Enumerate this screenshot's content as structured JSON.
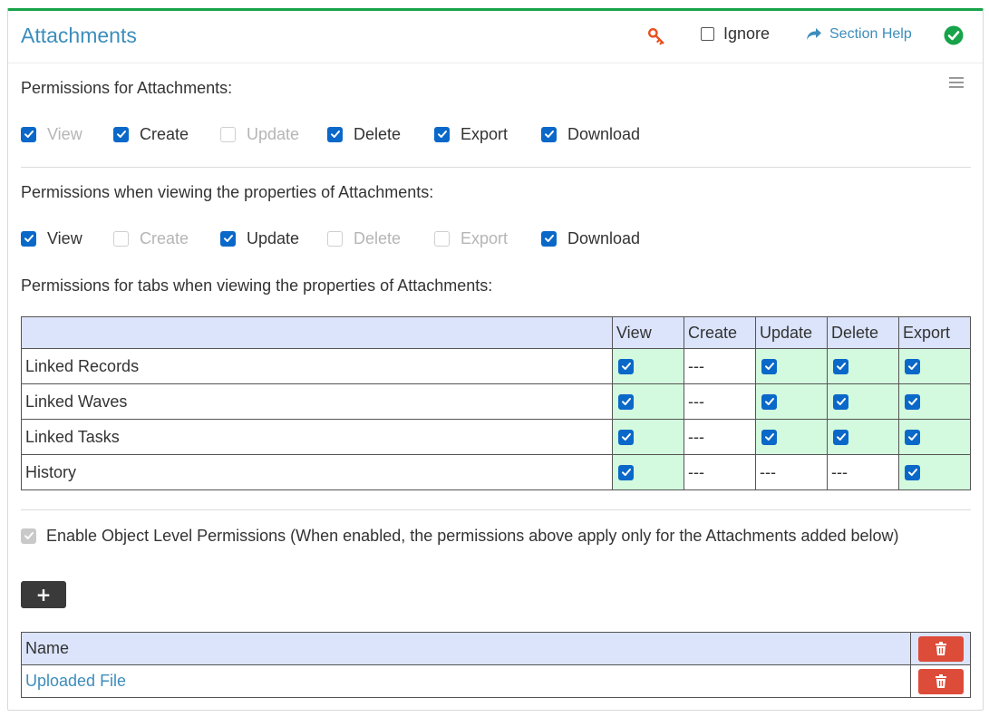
{
  "header": {
    "title": "Attachments",
    "ignore_label": "Ignore",
    "help_label": "Section Help"
  },
  "permissions": {
    "label": "Permissions for Attachments:",
    "items": [
      {
        "label": "View",
        "checked": true,
        "disabled": true
      },
      {
        "label": "Create",
        "checked": true,
        "disabled": false
      },
      {
        "label": "Update",
        "checked": false,
        "disabled": true
      },
      {
        "label": "Delete",
        "checked": true,
        "disabled": false
      },
      {
        "label": "Export",
        "checked": true,
        "disabled": false
      },
      {
        "label": "Download",
        "checked": true,
        "disabled": false
      }
    ]
  },
  "properties_permissions": {
    "label": "Permissions when viewing the properties of Attachments:",
    "items": [
      {
        "label": "View",
        "checked": true,
        "disabled": false
      },
      {
        "label": "Create",
        "checked": false,
        "disabled": true
      },
      {
        "label": "Update",
        "checked": true,
        "disabled": false
      },
      {
        "label": "Delete",
        "checked": false,
        "disabled": true
      },
      {
        "label": "Export",
        "checked": false,
        "disabled": true
      },
      {
        "label": "Download",
        "checked": true,
        "disabled": false
      }
    ]
  },
  "tabs_permissions": {
    "label": "Permissions for tabs when viewing the properties of Attachments:",
    "columns": [
      "View",
      "Create",
      "Update",
      "Delete",
      "Export"
    ],
    "rows": [
      {
        "name": "Linked Records",
        "cells": [
          "check",
          "---",
          "check",
          "check",
          "check"
        ]
      },
      {
        "name": "Linked Waves",
        "cells": [
          "check",
          "---",
          "check",
          "check",
          "check"
        ]
      },
      {
        "name": "Linked Tasks",
        "cells": [
          "check",
          "---",
          "check",
          "check",
          "check"
        ]
      },
      {
        "name": "History",
        "cells": [
          "check",
          "---",
          "---",
          "---",
          "check"
        ]
      }
    ]
  },
  "object_level": {
    "label": "Enable Object Level Permissions (When enabled, the permissions above apply only for the Attachments added below)",
    "checked": true
  },
  "objects_table": {
    "header": "Name",
    "rows": [
      {
        "name": "Uploaded File"
      }
    ]
  },
  "colors": {
    "accent": "#3c8dbc",
    "checkbox": "#0a68c9",
    "success": "#16a34a",
    "danger": "#dd4b39",
    "key": "#e8501f",
    "header_row": "#dbe4fb",
    "allowed_cell": "#d3fade"
  }
}
